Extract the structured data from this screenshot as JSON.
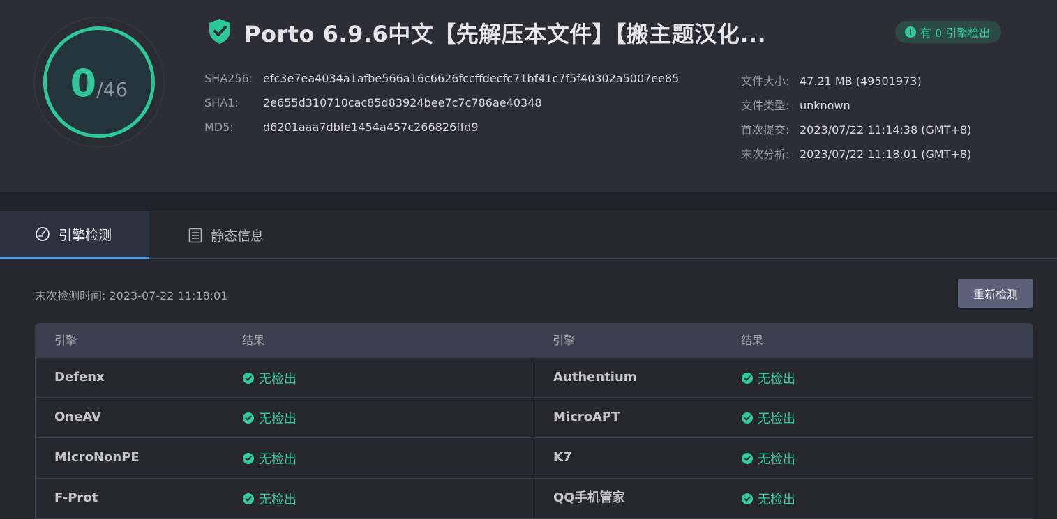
{
  "score": {
    "detected": "0",
    "total": "/46"
  },
  "title": "Porto 6.9.6中文【先解压本文件】【搬主题汉化...",
  "badge": "有 0 引擎检出",
  "hashes": [
    {
      "label": "SHA256:",
      "value": "efc3e7ea4034a1afbe566a16c6626fccffdecfc71bf41c7f5f40302a5007ee85"
    },
    {
      "label": "SHA1:",
      "value": "2e655d310710cac85d83924bee7c7c786ae40348"
    },
    {
      "label": "MD5:",
      "value": "d6201aaa7dbfe1454a457c266826ffd9"
    }
  ],
  "meta": [
    {
      "label": "文件大小:",
      "value": "47.21 MB (49501973)"
    },
    {
      "label": "文件类型:",
      "value": "unknown"
    },
    {
      "label": "首次提交:",
      "value": "2023/07/22 11:14:38 (GMT+8)"
    },
    {
      "label": "末次分析:",
      "value": "2023/07/22 11:18:01 (GMT+8)"
    }
  ],
  "tabs": [
    {
      "label": "引擎检测",
      "icon": "gauge-icon"
    },
    {
      "label": "静态信息",
      "icon": "list-icon"
    }
  ],
  "last_scan": "末次检测时间: 2023-07-22 11:18:01",
  "recheck_label": "重新检测",
  "table": {
    "headers": [
      "引擎",
      "结果",
      "引擎",
      "结果"
    ],
    "rows": [
      {
        "left_engine": "Defenx",
        "left_result": "无检出",
        "right_engine": "Authentium",
        "right_result": "无检出"
      },
      {
        "left_engine": "OneAV",
        "left_result": "无检出",
        "right_engine": "MicroAPT",
        "right_result": "无检出"
      },
      {
        "left_engine": "MicroNonPE",
        "left_result": "无检出",
        "right_engine": "K7",
        "right_result": "无检出"
      },
      {
        "left_engine": "F-Prot",
        "left_result": "无检出",
        "right_engine": "QQ手机管家",
        "right_result": "无检出"
      }
    ]
  },
  "colors": {
    "accent_green": "#33c99c",
    "tab_underline": "#4aa0e6",
    "button_bg": "#5c6078"
  }
}
